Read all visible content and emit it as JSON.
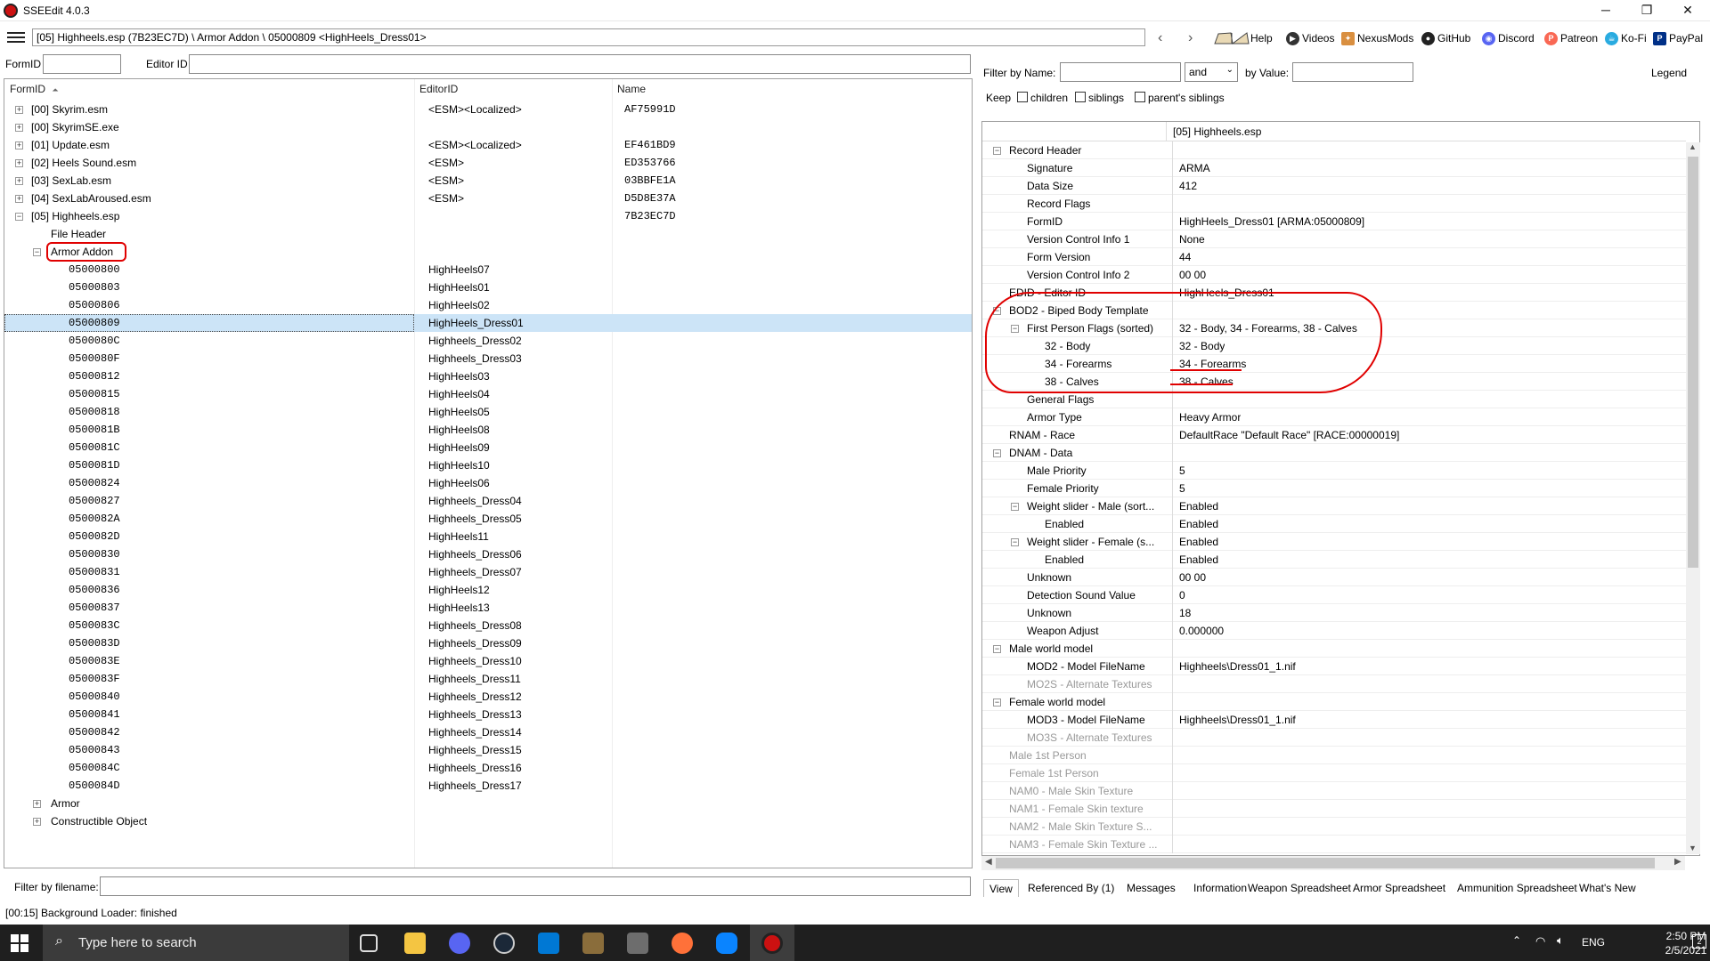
{
  "app": {
    "title": "SSEEdit 4.0.3"
  },
  "window_controls": {
    "minimize": "─",
    "restore": "❐",
    "close": "✕"
  },
  "path_bar": {
    "path": "[05] Highheels.esp (7B23EC7D) \\ Armor Addon \\ 05000809 <HighHeels_Dress01>",
    "back": "‹",
    "forward": "›"
  },
  "toolbar": {
    "help": "Help",
    "videos": "Videos",
    "nexusmods": "NexusMods",
    "github": "GitHub",
    "discord": "Discord",
    "patreon": "Patreon",
    "kofi": "Ko-Fi",
    "paypal": "PayPal"
  },
  "left_filter": {
    "formid_label": "FormID",
    "editorid_label": "Editor ID",
    "formid_value": "",
    "editorid_value": ""
  },
  "tree": {
    "columns": {
      "formid": "FormID",
      "editorid": "EditorID",
      "name": "Name"
    },
    "sort_indicator": "⏶",
    "files": [
      {
        "label": "[00] Skyrim.esm",
        "editorid": "<ESM><Localized>",
        "name": "AF75991D"
      },
      {
        "label": "[00] SkyrimSE.exe",
        "editorid": "",
        "name": ""
      },
      {
        "label": "[01] Update.esm",
        "editorid": "<ESM><Localized>",
        "name": "EF461BD9"
      },
      {
        "label": "[02] Heels Sound.esm",
        "editorid": "<ESM>",
        "name": "ED353766"
      },
      {
        "label": "[03] SexLab.esm",
        "editorid": "<ESM>",
        "name": "03BBFE1A"
      },
      {
        "label": "[04] SexLabAroused.esm",
        "editorid": "<ESM>",
        "name": "D5D8E37A"
      },
      {
        "label": "[05] Highheels.esp",
        "editorid": "",
        "name": "7B23EC7D"
      }
    ],
    "file_header": "File Header",
    "armor_addon": "Armor Addon",
    "records": [
      {
        "formid": "05000800",
        "editorid": "HighHeels07"
      },
      {
        "formid": "05000803",
        "editorid": "HighHeels01"
      },
      {
        "formid": "05000806",
        "editorid": "HighHeels02"
      },
      {
        "formid": "05000809",
        "editorid": "HighHeels_Dress01"
      },
      {
        "formid": "0500080C",
        "editorid": "Highheels_Dress02"
      },
      {
        "formid": "0500080F",
        "editorid": "Highheels_Dress03"
      },
      {
        "formid": "05000812",
        "editorid": "HighHeels03"
      },
      {
        "formid": "05000815",
        "editorid": "HighHeels04"
      },
      {
        "formid": "05000818",
        "editorid": "HighHeels05"
      },
      {
        "formid": "0500081B",
        "editorid": "HighHeels08"
      },
      {
        "formid": "0500081C",
        "editorid": "HighHeels09"
      },
      {
        "formid": "0500081D",
        "editorid": "HighHeels10"
      },
      {
        "formid": "05000824",
        "editorid": "HighHeels06"
      },
      {
        "formid": "05000827",
        "editorid": "Highheels_Dress04"
      },
      {
        "formid": "0500082A",
        "editorid": "Highheels_Dress05"
      },
      {
        "formid": "0500082D",
        "editorid": "HighHeels11"
      },
      {
        "formid": "05000830",
        "editorid": "Highheels_Dress06"
      },
      {
        "formid": "05000831",
        "editorid": "Highheels_Dress07"
      },
      {
        "formid": "05000836",
        "editorid": "HighHeels12"
      },
      {
        "formid": "05000837",
        "editorid": "HighHeels13"
      },
      {
        "formid": "0500083C",
        "editorid": "Highheels_Dress08"
      },
      {
        "formid": "0500083D",
        "editorid": "Highheels_Dress09"
      },
      {
        "formid": "0500083E",
        "editorid": "Highheels_Dress10"
      },
      {
        "formid": "0500083F",
        "editorid": "Highheels_Dress11"
      },
      {
        "formid": "05000840",
        "editorid": "Highheels_Dress12"
      },
      {
        "formid": "05000841",
        "editorid": "Highheels_Dress13"
      },
      {
        "formid": "05000842",
        "editorid": "Highheels_Dress14"
      },
      {
        "formid": "05000843",
        "editorid": "Highheels_Dress15"
      },
      {
        "formid": "0500084C",
        "editorid": "Highheels_Dress16"
      },
      {
        "formid": "0500084D",
        "editorid": "Highheels_Dress17"
      }
    ],
    "armor": "Armor",
    "constructible_object": "Constructible Object"
  },
  "file_filter": {
    "label": "Filter by filename:",
    "value": ""
  },
  "status": {
    "text": "[00:15] Background Loader: finished"
  },
  "right_filter": {
    "by_name": "Filter by Name:",
    "and": "and",
    "by_value": "by Value:",
    "legend": "Legend",
    "keep": "Keep",
    "children": "children",
    "siblings": "siblings",
    "parents_siblings": "parent's siblings"
  },
  "record_view": {
    "header": "[05] Highheels.esp",
    "rows": [
      {
        "label": "Record Header",
        "value": "",
        "indent": 0,
        "toggle": "⊟",
        "muted": false
      },
      {
        "label": "Signature",
        "value": "ARMA",
        "indent": 1,
        "toggle": "",
        "muted": false
      },
      {
        "label": "Data Size",
        "value": "412",
        "indent": 1,
        "toggle": "",
        "muted": false
      },
      {
        "label": "Record Flags",
        "value": "",
        "indent": 1,
        "toggle": "",
        "muted": false
      },
      {
        "label": "FormID",
        "value": "HighHeels_Dress01 [ARMA:05000809]",
        "indent": 1,
        "toggle": "",
        "muted": false
      },
      {
        "label": "Version Control Info 1",
        "value": "None",
        "indent": 1,
        "toggle": "",
        "muted": false
      },
      {
        "label": "Form Version",
        "value": "44",
        "indent": 1,
        "toggle": "",
        "muted": false
      },
      {
        "label": "Version Control Info 2",
        "value": "00 00",
        "indent": 1,
        "toggle": "",
        "muted": false
      },
      {
        "label": "EDID - Editor ID",
        "value": "HighHeels_Dress01",
        "indent": 0,
        "toggle": "",
        "muted": false
      },
      {
        "label": "BOD2 - Biped Body Template",
        "value": "",
        "indent": 0,
        "toggle": "⊟",
        "muted": false
      },
      {
        "label": "First Person Flags (sorted)",
        "value": "32 - Body, 34 - Forearms, 38 - Calves",
        "indent": 1,
        "toggle": "⊟",
        "muted": false
      },
      {
        "label": "32 - Body",
        "value": "32 - Body",
        "indent": 2,
        "toggle": "",
        "muted": false
      },
      {
        "label": "34 - Forearms",
        "value": "34 - Forearms",
        "indent": 2,
        "toggle": "",
        "muted": false
      },
      {
        "label": "38 - Calves",
        "value": "38 - Calves",
        "indent": 2,
        "toggle": "",
        "muted": false
      },
      {
        "label": "General Flags",
        "value": "",
        "indent": 1,
        "toggle": "",
        "muted": false
      },
      {
        "label": "Armor Type",
        "value": "Heavy Armor",
        "indent": 1,
        "toggle": "",
        "muted": false
      },
      {
        "label": "RNAM - Race",
        "value": "DefaultRace \"Default Race\" [RACE:00000019]",
        "indent": 0,
        "toggle": "",
        "muted": false
      },
      {
        "label": "DNAM - Data",
        "value": "",
        "indent": 0,
        "toggle": "⊟",
        "muted": false
      },
      {
        "label": "Male Priority",
        "value": "5",
        "indent": 1,
        "toggle": "",
        "muted": false
      },
      {
        "label": "Female Priority",
        "value": "5",
        "indent": 1,
        "toggle": "",
        "muted": false
      },
      {
        "label": "Weight slider - Male (sort...",
        "value": "Enabled",
        "indent": 1,
        "toggle": "⊟",
        "muted": false
      },
      {
        "label": "Enabled",
        "value": "Enabled",
        "indent": 2,
        "toggle": "",
        "muted": false
      },
      {
        "label": "Weight slider - Female (s...",
        "value": "Enabled",
        "indent": 1,
        "toggle": "⊟",
        "muted": false
      },
      {
        "label": "Enabled",
        "value": "Enabled",
        "indent": 2,
        "toggle": "",
        "muted": false
      },
      {
        "label": "Unknown",
        "value": "00 00",
        "indent": 1,
        "toggle": "",
        "muted": false
      },
      {
        "label": "Detection Sound Value",
        "value": "0",
        "indent": 1,
        "toggle": "",
        "muted": false
      },
      {
        "label": "Unknown",
        "value": "18",
        "indent": 1,
        "toggle": "",
        "muted": false
      },
      {
        "label": "Weapon Adjust",
        "value": "0.000000",
        "indent": 1,
        "toggle": "",
        "muted": false
      },
      {
        "label": "Male world model",
        "value": "",
        "indent": 0,
        "toggle": "⊟",
        "muted": false
      },
      {
        "label": "MOD2 - Model FileName",
        "value": "Highheels\\Dress01_1.nif",
        "indent": 1,
        "toggle": "",
        "muted": false
      },
      {
        "label": "MO2S - Alternate Textures",
        "value": "",
        "indent": 1,
        "toggle": "",
        "muted": true
      },
      {
        "label": "Female world model",
        "value": "",
        "indent": 0,
        "toggle": "⊟",
        "muted": false
      },
      {
        "label": "MOD3 - Model FileName",
        "value": "Highheels\\Dress01_1.nif",
        "indent": 1,
        "toggle": "",
        "muted": false
      },
      {
        "label": "MO3S - Alternate Textures",
        "value": "",
        "indent": 1,
        "toggle": "",
        "muted": true
      },
      {
        "label": "Male 1st Person",
        "value": "",
        "indent": 0,
        "toggle": "",
        "muted": true
      },
      {
        "label": "Female 1st Person",
        "value": "",
        "indent": 0,
        "toggle": "",
        "muted": true
      },
      {
        "label": "NAM0 - Male Skin Texture",
        "value": "",
        "indent": 0,
        "toggle": "",
        "muted": true
      },
      {
        "label": "NAM1 - Female Skin texture",
        "value": "",
        "indent": 0,
        "toggle": "",
        "muted": true
      },
      {
        "label": "NAM2 - Male Skin Texture S...",
        "value": "",
        "indent": 0,
        "toggle": "",
        "muted": true
      },
      {
        "label": "NAM3 - Female Skin Texture ...",
        "value": "",
        "indent": 0,
        "toggle": "",
        "muted": true
      }
    ]
  },
  "tabs": [
    "View",
    "Referenced By (1)",
    "Messages",
    "Information",
    "Weapon Spreadsheet",
    "Armor Spreadsheet",
    "Ammunition Spreadsheet",
    "What's New"
  ],
  "taskbar": {
    "search_placeholder": "Type here to search",
    "lang": "ENG",
    "time": "2:50 PM",
    "date": "2/5/2021",
    "notif": "2"
  },
  "colors": {
    "selection": "#cce4f7",
    "annotation": "#e00000",
    "taskbar": "#1f1f1f"
  }
}
